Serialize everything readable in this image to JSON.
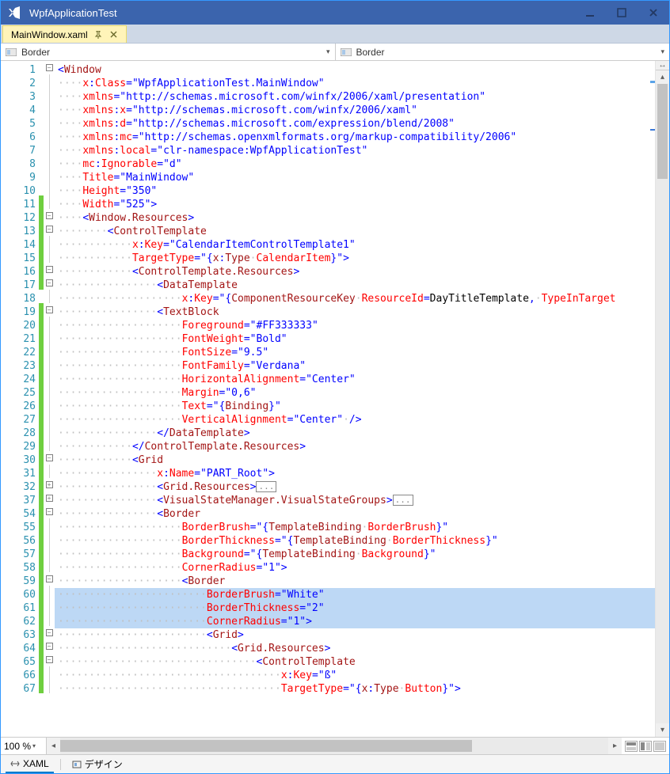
{
  "window": {
    "title": "WpfApplicationTest"
  },
  "tab": {
    "filename": "MainWindow.xaml"
  },
  "nav": {
    "left": "Border",
    "right": "Border"
  },
  "zoom": {
    "value": "100 %"
  },
  "bottom": {
    "xaml": "XAML",
    "design": "デザイン"
  },
  "lineNumbers": [
    1,
    2,
    3,
    4,
    5,
    6,
    7,
    8,
    9,
    10,
    11,
    12,
    13,
    14,
    15,
    16,
    17,
    18,
    19,
    20,
    21,
    22,
    23,
    24,
    25,
    26,
    27,
    28,
    29,
    30,
    31,
    32,
    37,
    54,
    55,
    56,
    57,
    58,
    59,
    60,
    61,
    62,
    63,
    64,
    65,
    66,
    67
  ],
  "markerGreen": [
    false,
    false,
    false,
    false,
    false,
    false,
    false,
    false,
    false,
    false,
    true,
    true,
    true,
    true,
    true,
    true,
    true,
    false,
    true,
    true,
    true,
    true,
    true,
    true,
    true,
    true,
    true,
    true,
    true,
    true,
    true,
    true,
    true,
    true,
    true,
    true,
    true,
    true,
    true,
    true,
    true,
    true,
    true,
    true,
    true,
    true,
    true
  ],
  "fold": [
    "minus",
    "",
    "",
    "",
    "",
    "",
    "",
    "",
    "",
    "",
    "",
    "minus",
    "minus",
    "",
    "",
    "minus",
    "minus",
    "",
    "minus",
    "",
    "",
    "",
    "",
    "",
    "",
    "",
    "",
    "",
    "",
    "minus",
    "",
    "plus",
    "plus",
    "minus",
    "",
    "",
    "",
    "",
    "minus",
    "",
    "",
    "",
    "minus",
    "minus",
    "minus",
    "",
    ""
  ],
  "highlight": [
    39,
    40,
    41
  ],
  "code": [
    [
      [
        "br",
        "<"
      ],
      [
        "el",
        "Window"
      ]
    ],
    [
      [
        "ws",
        "····"
      ],
      [
        "attr",
        "x"
      ],
      [
        "br",
        ":"
      ],
      [
        "attr",
        "Class"
      ],
      [
        "br",
        "="
      ],
      [
        "str",
        "\"WpfApplicationTest.MainWindow\""
      ]
    ],
    [
      [
        "ws",
        "····"
      ],
      [
        "attr",
        "xmlns"
      ],
      [
        "br",
        "="
      ],
      [
        "str",
        "\"http://schemas.microsoft.com/winfx/2006/xaml/presentation\""
      ]
    ],
    [
      [
        "ws",
        "····"
      ],
      [
        "attr",
        "xmlns"
      ],
      [
        "br",
        ":"
      ],
      [
        "attr",
        "x"
      ],
      [
        "br",
        "="
      ],
      [
        "str",
        "\"http://schemas.microsoft.com/winfx/2006/xaml\""
      ]
    ],
    [
      [
        "ws",
        "····"
      ],
      [
        "attr",
        "xmlns"
      ],
      [
        "br",
        ":"
      ],
      [
        "attr",
        "d"
      ],
      [
        "br",
        "="
      ],
      [
        "str",
        "\"http://schemas.microsoft.com/expression/blend/2008\""
      ]
    ],
    [
      [
        "ws",
        "····"
      ],
      [
        "attr",
        "xmlns"
      ],
      [
        "br",
        ":"
      ],
      [
        "attr",
        "mc"
      ],
      [
        "br",
        "="
      ],
      [
        "str",
        "\"http://schemas.openxmlformats.org/markup-compatibility/2006\""
      ]
    ],
    [
      [
        "ws",
        "····"
      ],
      [
        "attr",
        "xmlns"
      ],
      [
        "br",
        ":"
      ],
      [
        "attr",
        "local"
      ],
      [
        "br",
        "="
      ],
      [
        "str",
        "\"clr-namespace:WpfApplicationTest\""
      ]
    ],
    [
      [
        "ws",
        "····"
      ],
      [
        "attr",
        "mc"
      ],
      [
        "br",
        ":"
      ],
      [
        "attr",
        "Ignorable"
      ],
      [
        "br",
        "="
      ],
      [
        "str",
        "\"d\""
      ]
    ],
    [
      [
        "ws",
        "····"
      ],
      [
        "attr",
        "Title"
      ],
      [
        "br",
        "="
      ],
      [
        "str",
        "\"MainWindow\""
      ]
    ],
    [
      [
        "ws",
        "····"
      ],
      [
        "attr",
        "Height"
      ],
      [
        "br",
        "="
      ],
      [
        "str",
        "\"350\""
      ]
    ],
    [
      [
        "ws",
        "····"
      ],
      [
        "attr",
        "Width"
      ],
      [
        "br",
        "="
      ],
      [
        "str",
        "\"525\""
      ],
      [
        "br",
        ">"
      ]
    ],
    [
      [
        "ws",
        "····"
      ],
      [
        "br",
        "<"
      ],
      [
        "el",
        "Window.Resources"
      ],
      [
        "br",
        ">"
      ]
    ],
    [
      [
        "ws",
        "········"
      ],
      [
        "br",
        "<"
      ],
      [
        "el",
        "ControlTemplate"
      ]
    ],
    [
      [
        "ws",
        "············"
      ],
      [
        "attr",
        "x"
      ],
      [
        "br",
        ":"
      ],
      [
        "attr",
        "Key"
      ],
      [
        "br",
        "="
      ],
      [
        "str",
        "\"CalendarItemControlTemplate1\""
      ]
    ],
    [
      [
        "ws",
        "············"
      ],
      [
        "attr",
        "TargetType"
      ],
      [
        "br",
        "="
      ],
      [
        "str",
        "\"{"
      ],
      [
        "el",
        "x"
      ],
      [
        "str",
        ":"
      ],
      [
        "el",
        "Type·"
      ],
      [
        "attr",
        "CalendarItem"
      ],
      [
        "str",
        "}\""
      ],
      [
        "br",
        ">"
      ]
    ],
    [
      [
        "ws",
        "············"
      ],
      [
        "br",
        "<"
      ],
      [
        "el",
        "ControlTemplate.Resources"
      ],
      [
        "br",
        ">"
      ]
    ],
    [
      [
        "ws",
        "················"
      ],
      [
        "br",
        "<"
      ],
      [
        "el",
        "DataTemplate"
      ]
    ],
    [
      [
        "ws",
        "····················"
      ],
      [
        "attr",
        "x"
      ],
      [
        "br",
        ":"
      ],
      [
        "attr",
        "Key"
      ],
      [
        "br",
        "="
      ],
      [
        "str",
        "\"{"
      ],
      [
        "el",
        "ComponentResourceKey·"
      ],
      [
        "attr",
        "ResourceId"
      ],
      [
        "str",
        "="
      ],
      [
        "txt",
        "DayTitleTemplate"
      ],
      [
        "str",
        ",·"
      ],
      [
        "attr",
        "TypeInTarget"
      ]
    ],
    [
      [
        "ws",
        "················"
      ],
      [
        "br",
        "<"
      ],
      [
        "el",
        "TextBlock"
      ]
    ],
    [
      [
        "ws",
        "····················"
      ],
      [
        "attr",
        "Foreground"
      ],
      [
        "br",
        "="
      ],
      [
        "str",
        "\"#FF333333\""
      ]
    ],
    [
      [
        "ws",
        "····················"
      ],
      [
        "attr",
        "FontWeight"
      ],
      [
        "br",
        "="
      ],
      [
        "str",
        "\"Bold\""
      ]
    ],
    [
      [
        "ws",
        "····················"
      ],
      [
        "attr",
        "FontSize"
      ],
      [
        "br",
        "="
      ],
      [
        "str",
        "\"9.5\""
      ]
    ],
    [
      [
        "ws",
        "····················"
      ],
      [
        "attr",
        "FontFamily"
      ],
      [
        "br",
        "="
      ],
      [
        "str",
        "\"Verdana\""
      ]
    ],
    [
      [
        "ws",
        "····················"
      ],
      [
        "attr",
        "HorizontalAlignment"
      ],
      [
        "br",
        "="
      ],
      [
        "str",
        "\"Center\""
      ]
    ],
    [
      [
        "ws",
        "····················"
      ],
      [
        "attr",
        "Margin"
      ],
      [
        "br",
        "="
      ],
      [
        "str",
        "\"0,6\""
      ]
    ],
    [
      [
        "ws",
        "····················"
      ],
      [
        "attr",
        "Text"
      ],
      [
        "br",
        "="
      ],
      [
        "str",
        "\"{"
      ],
      [
        "el",
        "Binding"
      ],
      [
        "str",
        "}\""
      ]
    ],
    [
      [
        "ws",
        "····················"
      ],
      [
        "attr",
        "VerticalAlignment"
      ],
      [
        "br",
        "="
      ],
      [
        "str",
        "\"Center\""
      ],
      [
        "br",
        "·/>"
      ]
    ],
    [
      [
        "ws",
        "················"
      ],
      [
        "br",
        "</"
      ],
      [
        "el",
        "DataTemplate"
      ],
      [
        "br",
        ">"
      ]
    ],
    [
      [
        "ws",
        "············"
      ],
      [
        "br",
        "</"
      ],
      [
        "el",
        "ControlTemplate.Resources"
      ],
      [
        "br",
        ">"
      ]
    ],
    [
      [
        "ws",
        "············"
      ],
      [
        "br",
        "<"
      ],
      [
        "el",
        "Grid"
      ]
    ],
    [
      [
        "ws",
        "················"
      ],
      [
        "attr",
        "x"
      ],
      [
        "br",
        ":"
      ],
      [
        "attr",
        "Name"
      ],
      [
        "br",
        "="
      ],
      [
        "str",
        "\"PART_Root\""
      ],
      [
        "br",
        ">"
      ]
    ],
    [
      [
        "ws",
        "················"
      ],
      [
        "br",
        "<"
      ],
      [
        "el",
        "Grid.Resources"
      ],
      [
        "br",
        ">"
      ],
      [
        "colbox",
        "..."
      ]
    ],
    [
      [
        "ws",
        "················"
      ],
      [
        "br",
        "<"
      ],
      [
        "el",
        "VisualStateManager.VisualStateGroups"
      ],
      [
        "br",
        ">"
      ],
      [
        "colbox",
        "..."
      ]
    ],
    [
      [
        "ws",
        "················"
      ],
      [
        "br",
        "<"
      ],
      [
        "el",
        "Border"
      ]
    ],
    [
      [
        "ws",
        "····················"
      ],
      [
        "attr",
        "BorderBrush"
      ],
      [
        "br",
        "="
      ],
      [
        "str",
        "\"{"
      ],
      [
        "el",
        "TemplateBinding·"
      ],
      [
        "attr",
        "BorderBrush"
      ],
      [
        "str",
        "}\""
      ]
    ],
    [
      [
        "ws",
        "····················"
      ],
      [
        "attr",
        "BorderThickness"
      ],
      [
        "br",
        "="
      ],
      [
        "str",
        "\"{"
      ],
      [
        "el",
        "TemplateBinding·"
      ],
      [
        "attr",
        "BorderThickness"
      ],
      [
        "str",
        "}\""
      ]
    ],
    [
      [
        "ws",
        "····················"
      ],
      [
        "attr",
        "Background"
      ],
      [
        "br",
        "="
      ],
      [
        "str",
        "\"{"
      ],
      [
        "el",
        "TemplateBinding·"
      ],
      [
        "attr",
        "Background"
      ],
      [
        "str",
        "}\""
      ]
    ],
    [
      [
        "ws",
        "····················"
      ],
      [
        "attr",
        "CornerRadius"
      ],
      [
        "br",
        "="
      ],
      [
        "str",
        "\"1\""
      ],
      [
        "br",
        ">"
      ]
    ],
    [
      [
        "ws",
        "····················"
      ],
      [
        "br",
        "<"
      ],
      [
        "el",
        "Border"
      ]
    ],
    [
      [
        "ws",
        "························"
      ],
      [
        "attr",
        "BorderBrush"
      ],
      [
        "br",
        "="
      ],
      [
        "str",
        "\"White\""
      ]
    ],
    [
      [
        "ws",
        "························"
      ],
      [
        "attr",
        "BorderThickness"
      ],
      [
        "br",
        "="
      ],
      [
        "str",
        "\"2\""
      ]
    ],
    [
      [
        "ws",
        "························"
      ],
      [
        "attr",
        "CornerRadius"
      ],
      [
        "br",
        "="
      ],
      [
        "str",
        "\"1\""
      ],
      [
        "br",
        ">"
      ]
    ],
    [
      [
        "ws",
        "························"
      ],
      [
        "br",
        "<"
      ],
      [
        "el",
        "Grid"
      ],
      [
        "br",
        ">"
      ]
    ],
    [
      [
        "ws",
        "····························"
      ],
      [
        "br",
        "<"
      ],
      [
        "el",
        "Grid.Resources"
      ],
      [
        "br",
        ">"
      ]
    ],
    [
      [
        "ws",
        "································"
      ],
      [
        "br",
        "<"
      ],
      [
        "el",
        "ControlTemplate"
      ]
    ],
    [
      [
        "ws",
        "····································"
      ],
      [
        "attr",
        "x"
      ],
      [
        "br",
        ":"
      ],
      [
        "attr",
        "Key"
      ],
      [
        "br",
        "="
      ],
      [
        "str",
        "\"ß\""
      ]
    ],
    [
      [
        "ws",
        "····································"
      ],
      [
        "attr",
        "TargetType"
      ],
      [
        "br",
        "="
      ],
      [
        "str",
        "\"{"
      ],
      [
        "el",
        "x"
      ],
      [
        "str",
        ":"
      ],
      [
        "el",
        "Type·"
      ],
      [
        "attr",
        "Button"
      ],
      [
        "str",
        "}\""
      ],
      [
        "br",
        ">"
      ]
    ]
  ]
}
